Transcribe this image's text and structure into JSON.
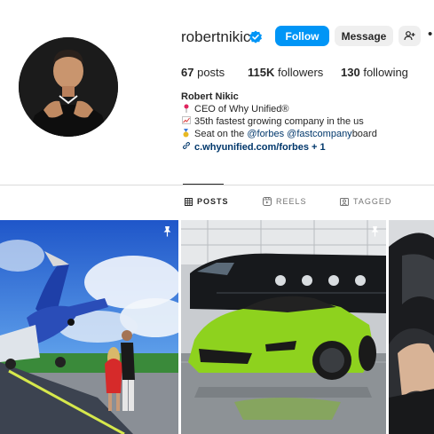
{
  "profile": {
    "username": "robertnikic",
    "follow_label": "Follow",
    "message_label": "Message",
    "more_label": "•",
    "stats": {
      "posts_count": "67",
      "posts_label": "posts",
      "followers_count": "115K",
      "followers_label": "followers",
      "following_count": "130",
      "following_label": "following"
    },
    "bio": {
      "name": "Robert Nikic",
      "line1": "CEO of Why Unified®",
      "line2": "35th fastest growing company in the us",
      "line3_prefix": "Seat on the ",
      "mention1": "@forbes",
      "mention2": "@fastcompany",
      "line3_suffix": " board",
      "link": "c.whyunified.com/forbes + 1"
    }
  },
  "tabs": [
    {
      "label": "POSTS",
      "icon": "grid-icon",
      "active": true
    },
    {
      "label": "REELS",
      "icon": "reels-icon",
      "active": false
    },
    {
      "label": "TAGGED",
      "icon": "tagged-icon",
      "active": false
    }
  ],
  "posts": [
    {
      "icon": "pin-icon",
      "pinned": true
    },
    {
      "icon": "pin-icon",
      "pinned": true
    },
    {
      "pinned": false
    }
  ],
  "colors": {
    "accent": "#0095f6",
    "verified": "#0095f6",
    "link": "#00376b",
    "lime_car": "#8ed21e"
  }
}
